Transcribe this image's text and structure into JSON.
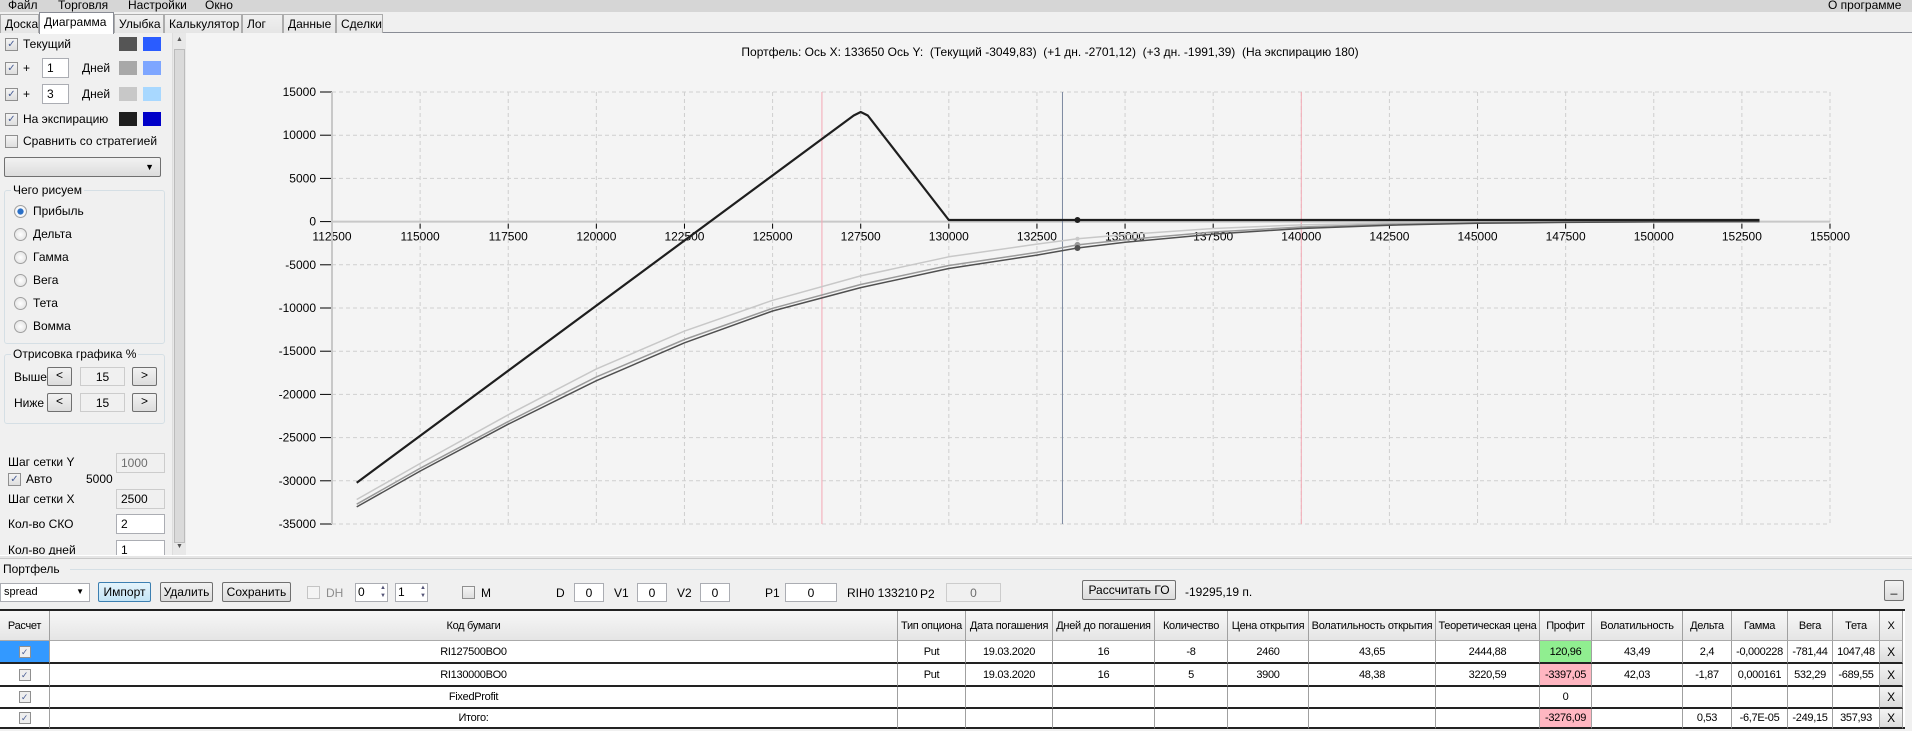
{
  "menu": [
    "Файл",
    "Торговля",
    "Настройки",
    "Окно"
  ],
  "menu_right": "О программе",
  "tabs": [
    "Доска",
    "Диаграмма",
    "Улыбка",
    "Калькулятор",
    "Лог",
    "Данные",
    "Сделки"
  ],
  "active_tab": "Диаграмма",
  "left": {
    "current_label": "Текущий",
    "plus": "+",
    "days_label": "Дней",
    "plus1_value": "1",
    "plus3_value": "3",
    "expiration_label": "На экспирацию",
    "compare_label": "Сравнить со стратегией",
    "compare_select": "",
    "draw_group": "Чего рисуем",
    "draw_options": [
      "Прибыль",
      "Дельта",
      "Гамма",
      "Вега",
      "Тета",
      "Вомма"
    ],
    "draw_selected": "Прибыль",
    "render_group": "Отрисовка графика %",
    "above_label": "Выше",
    "below_label": "Ниже",
    "above_value": "15",
    "below_value": "15",
    "dec": "<",
    "inc": ">",
    "grid_y_label": "Шаг сетки Y",
    "grid_y_value": "1000",
    "auto_label": "Авто",
    "auto_value": "5000",
    "grid_x_label": "Шаг сетки X",
    "grid_x_value": "2500",
    "sko_label": "Кол-во СКО",
    "sko_value": "2",
    "days_count_label": "Кол-во дней",
    "days_count_value": "1",
    "colors": {
      "current": [
        "#555555",
        "#2a5cff"
      ],
      "plus1": [
        "#a8a8a8",
        "#7ea6ff"
      ],
      "plus3": [
        "#c8c8c8",
        "#a8d8ff"
      ],
      "expiration": [
        "#1e1e1e",
        "#0000c8"
      ]
    }
  },
  "chart_title": "Портфель: Ось X: 133650 Ось Y:  (Текущий -3049,83)  (+1 дн. -2701,12)  (+3 дн. -1991,39)  (На экспирацию 180)",
  "chart_data": {
    "type": "line",
    "title": "Портфель: Ось X: 133650 Ось Y:  (Текущий -3049,83)  (+1 дн. -2701,12)  (+3 дн. -1991,39)  (На экспирацию 180)",
    "xlim": [
      112500,
      155000
    ],
    "ylim": [
      -35000,
      15000
    ],
    "x_ticks": [
      112500,
      115000,
      117500,
      120000,
      122500,
      125000,
      127500,
      130000,
      132500,
      135000,
      137500,
      140000,
      142500,
      145000,
      147500,
      150000,
      152500,
      155000
    ],
    "y_ticks": [
      15000,
      10000,
      5000,
      0,
      -5000,
      -10000,
      -15000,
      -20000,
      -25000,
      -30000,
      -35000
    ],
    "grid": true,
    "cursor_x": 133650,
    "sigma_lines_x": [
      126400,
      140000
    ],
    "x": [
      113200,
      115000,
      117500,
      120000,
      122500,
      125000,
      127500,
      130000,
      132500,
      133650,
      135000,
      137500,
      140000,
      142500,
      145000,
      147500,
      150000,
      153000
    ],
    "series": [
      {
        "name": "Текущий",
        "color": "#505050",
        "values": [
          -33020,
          -28880,
          -23450,
          -18410,
          -14030,
          -10350,
          -7640,
          -5430,
          -3880,
          -3050,
          -2400,
          -1450,
          -800,
          -420,
          -200,
          -90,
          -30,
          -5
        ]
      },
      {
        "name": "+1 дн.",
        "color": "#9a9a9a",
        "values": [
          -32710,
          -28550,
          -23150,
          -17980,
          -13650,
          -10040,
          -7280,
          -5080,
          -3560,
          -2701,
          -2100,
          -1200,
          -620,
          -300,
          -140,
          -60,
          -20,
          -5
        ]
      },
      {
        "name": "+3 дн.",
        "color": "#c8c8c8",
        "values": [
          -32170,
          -28000,
          -22360,
          -17050,
          -12670,
          -9110,
          -6280,
          -4070,
          -2600,
          -1991,
          -1500,
          -800,
          -380,
          -170,
          -70,
          -30,
          -10,
          -2
        ]
      },
      {
        "name": "На экспирацию",
        "color": "#1e1e1e",
        "x": [
          113200,
          127300,
          127500,
          127700,
          130000,
          153000
        ],
        "values": [
          -30220,
          12280,
          12680,
          12280,
          180,
          180
        ]
      }
    ]
  },
  "portfolio": {
    "group_label": "Портфель",
    "strategy": "spread",
    "import": "Импорт",
    "delete": "Удалить",
    "save": "Сохранить",
    "dh_label": "DH",
    "spin1": "0",
    "spin2": "1",
    "m_label": "M",
    "d_label": "D",
    "d_value": "0",
    "v1_label": "V1",
    "v1_value": "0",
    "v2_label": "V2",
    "v2_value": "0",
    "p1_label": "P1",
    "p1_value": "0",
    "rih": "RIH0 133210",
    "p2_label": "P2",
    "p2_value": "0",
    "calc_go": "Рассчитать ГО",
    "go_value": "-19295,19 п.",
    "minimize": "_"
  },
  "table": {
    "headers": [
      "Расчет",
      "Код бумаги",
      "Тип опциона",
      "Дата погашения",
      "Дней до погашения",
      "Количество",
      "Цена открытия",
      "Волатильность открытия",
      "Теоретическая цена",
      "Профит",
      "Волатильность",
      "Дельта",
      "Гамма",
      "Вега",
      "Тета",
      "X"
    ],
    "rows": [
      [
        "✓",
        "RI127500BO0",
        "Put",
        "19.03.2020",
        "16",
        "-8",
        "2460",
        "43,65",
        "2444,88",
        "120,96",
        "43,49",
        "2,4",
        "-0,000228",
        "-781,44",
        "1047,48",
        "X"
      ],
      [
        "✓",
        "RI130000BO0",
        "Put",
        "19.03.2020",
        "16",
        "5",
        "3900",
        "48,38",
        "3220,59",
        "-3397,05",
        "42,03",
        "-1,87",
        "0,000161",
        "532,29",
        "-689,55",
        "X"
      ],
      [
        "✓",
        "FixedProfit",
        "",
        "",
        "",
        "",
        "",
        "",
        "",
        "0",
        "",
        "",
        "",
        "",
        "",
        "X"
      ],
      [
        "✓",
        "Итого:",
        "",
        "",
        "",
        "",
        "",
        "",
        "",
        "-3276,09",
        "",
        "0,53",
        "-6,7E-05",
        "-249,15",
        "357,93",
        "X"
      ]
    ],
    "profit_colors": [
      "#90ee90",
      "#ffb6c1",
      "#ffffff",
      "#ffb6c1"
    ],
    "selected_color": "#3399ff"
  }
}
